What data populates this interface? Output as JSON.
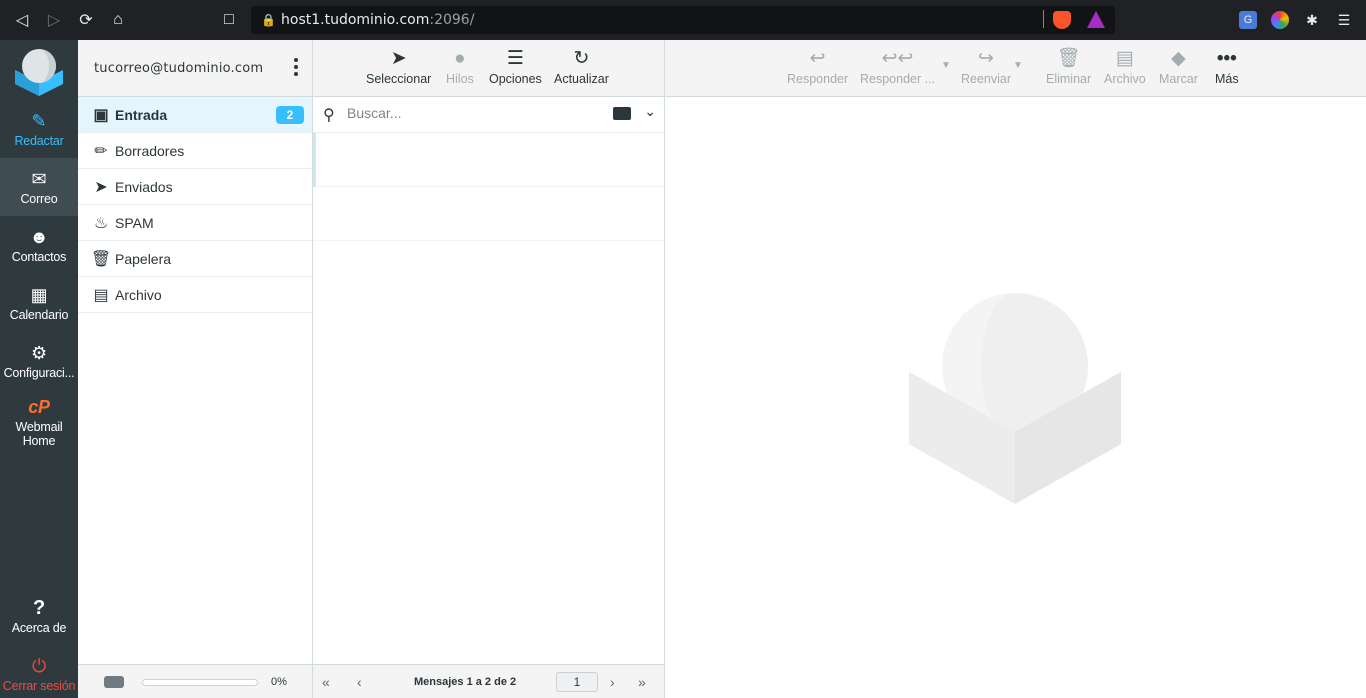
{
  "browser": {
    "url_host": "host1.tudominio.com",
    "url_port": ":2096/"
  },
  "nav": {
    "compose": "Redactar",
    "mail": "Correo",
    "contacts": "Contactos",
    "calendar": "Calendario",
    "settings": "Configuraci...",
    "webmail_home_line1": "Webmail",
    "webmail_home_line2": "Home",
    "about": "Acerca de",
    "logout": "Cerrar sesión"
  },
  "account": "tucorreo@tudominio.com",
  "folders": [
    {
      "label": "Entrada",
      "icon": "inbox-icon",
      "unread": "2"
    },
    {
      "label": "Borradores",
      "icon": "pencil-icon"
    },
    {
      "label": "Enviados",
      "icon": "paper-plane-icon"
    },
    {
      "label": "SPAM",
      "icon": "fire-icon"
    },
    {
      "label": "Papelera",
      "icon": "trash-icon"
    },
    {
      "label": "Archivo",
      "icon": "archive-icon"
    }
  ],
  "quota": {
    "percent_label": "0%",
    "fraction": 0
  },
  "list_toolbar": {
    "select": "Seleccionar",
    "threads": "Hilos",
    "options": "Opciones",
    "refresh": "Actualizar"
  },
  "search": {
    "placeholder": "Buscar..."
  },
  "pager": {
    "count": "Mensajes 1 a 2 de 2",
    "page": "1"
  },
  "message_toolbar": {
    "reply": "Responder",
    "reply_all": "Responder ...",
    "forward": "Reenviar",
    "delete": "Eliminar",
    "archive": "Archivo",
    "mark": "Marcar",
    "more": "Más"
  },
  "colors": {
    "accent": "#37beff",
    "nav_bg": "#2f3a3f",
    "logout": "#f04a3e",
    "cpanel": "#ff6c2c"
  }
}
